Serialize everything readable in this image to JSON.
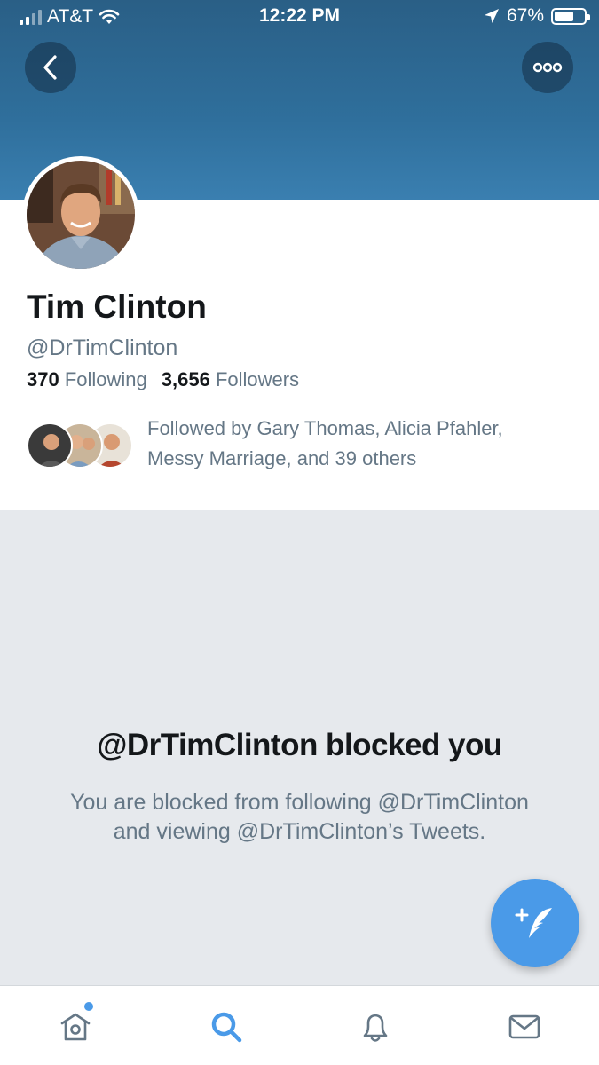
{
  "status_bar": {
    "carrier": "AT&T",
    "time": "12:22 PM",
    "battery": "67%",
    "battery_level": 0.67
  },
  "header": {
    "back_icon": "chevron-left-icon",
    "more_icon": "more-horizontal-icon"
  },
  "profile": {
    "name": "Tim Clinton",
    "handle": "@DrTimClinton",
    "following_count": "370",
    "following_label": "Following",
    "followers_count": "3,656",
    "followers_label": "Followers",
    "followed_by": "Followed by Gary Thomas, Alicia Pfahler, Messy Marriage, and 39 others"
  },
  "blocked": {
    "title": "@DrTimClinton blocked you",
    "description": "You are blocked from following @DrTimClinton and viewing @DrTimClinton’s Tweets."
  },
  "tabs": [
    {
      "icon": "home-icon",
      "active": false,
      "has_badge": true
    },
    {
      "icon": "search-icon",
      "active": true
    },
    {
      "icon": "bell-icon",
      "active": false
    },
    {
      "icon": "mail-icon",
      "active": false
    }
  ],
  "colors": {
    "accent": "#4a9ae8",
    "banner": "#2f6f9c",
    "background": "#e6e9ed",
    "muted_text": "#657786"
  }
}
